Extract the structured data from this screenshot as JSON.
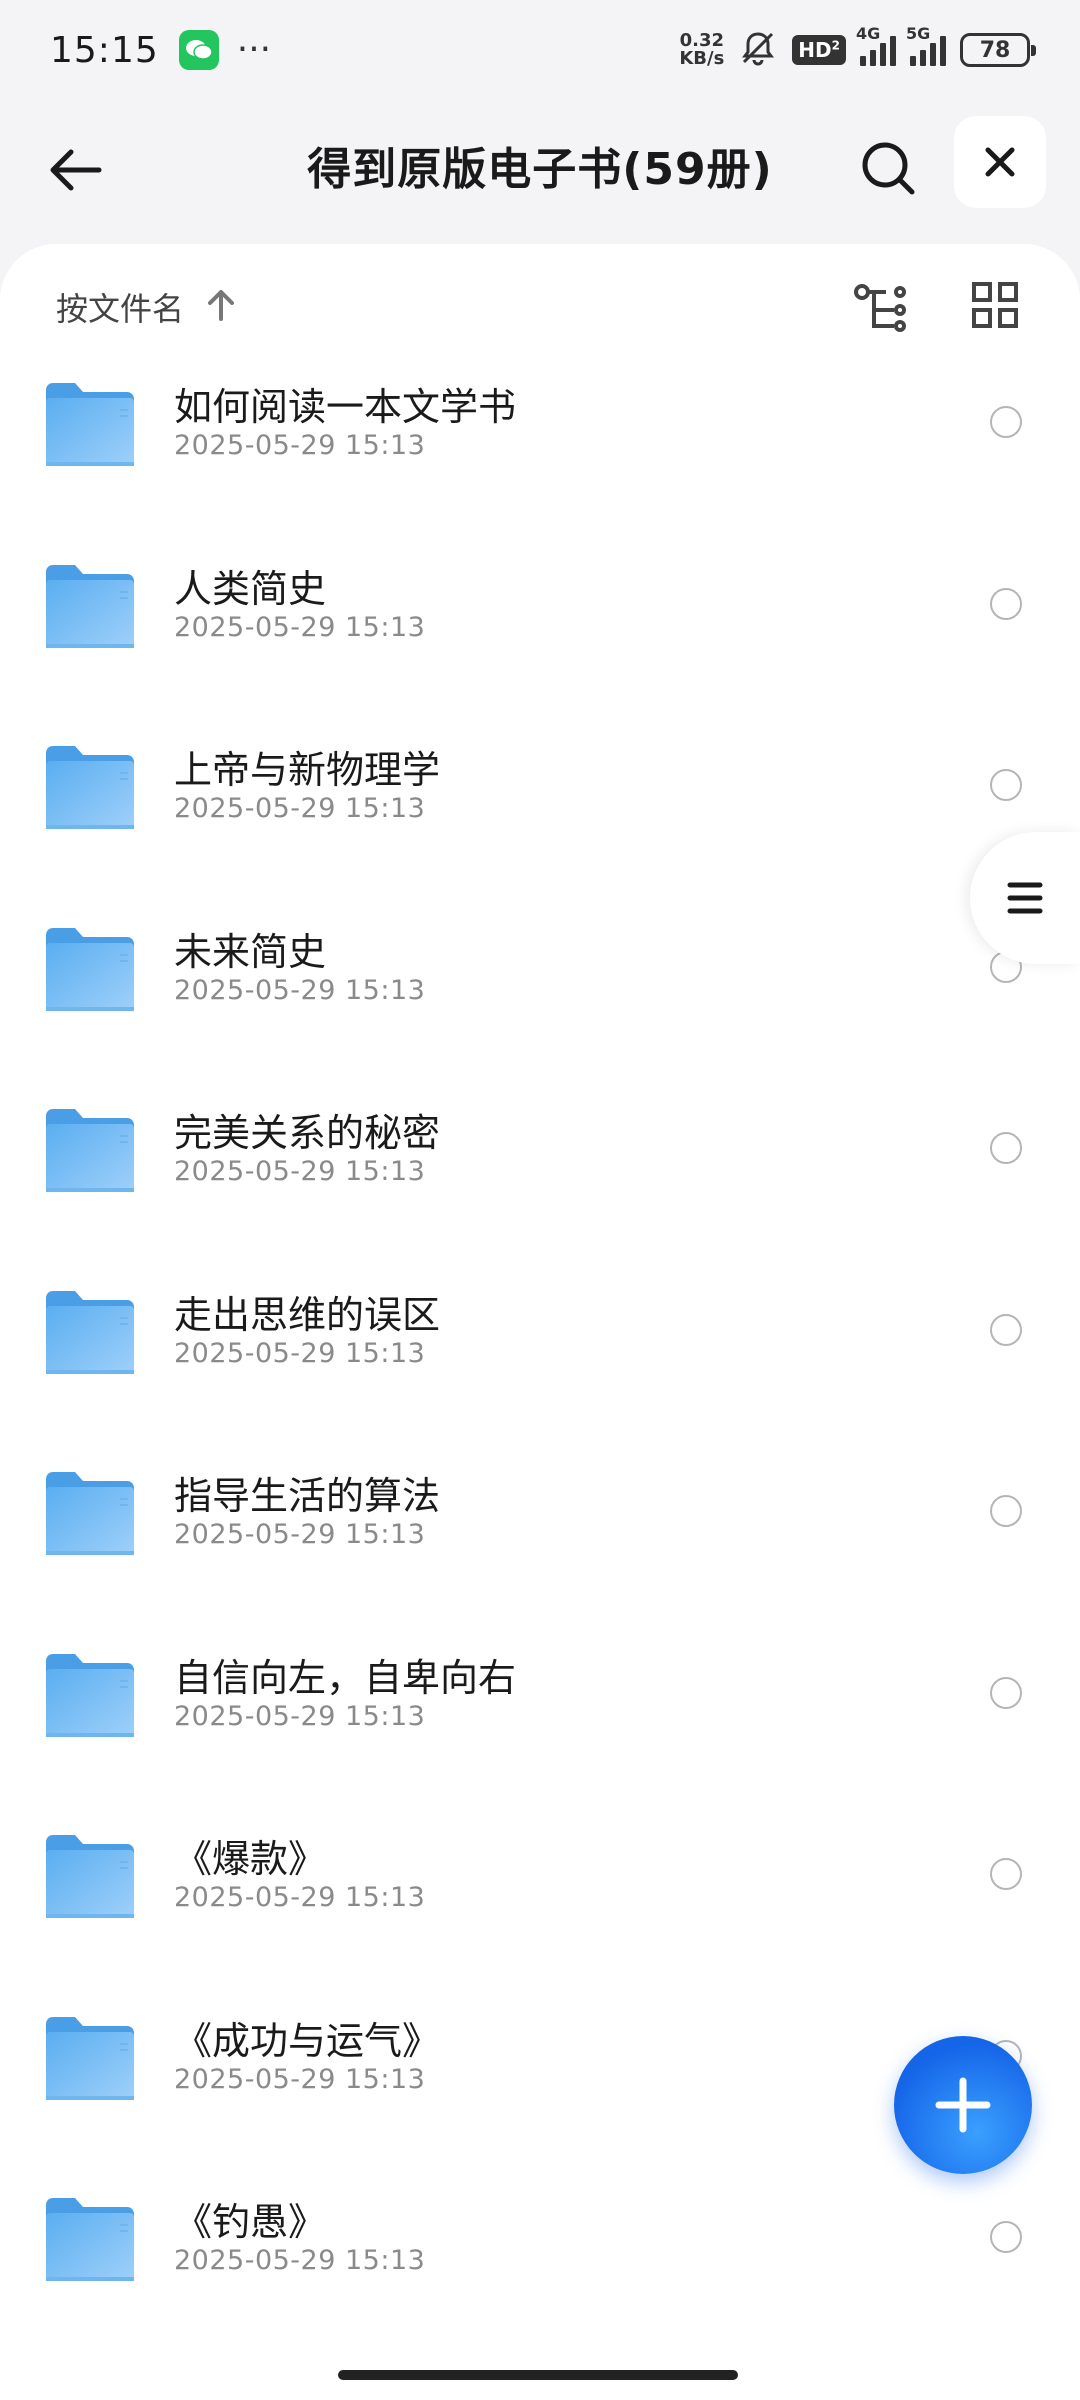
{
  "status_bar": {
    "time": "15:15",
    "dots": "···",
    "net_speed_value": "0.32",
    "net_speed_unit": "KB/s",
    "hd_label": "HD",
    "hd_sub": "2",
    "net_4g": "4G",
    "net_5g": "5G",
    "battery": "78"
  },
  "header": {
    "title": "得到原版电子书(59册)"
  },
  "toolbar": {
    "sort_label": "按文件名"
  },
  "files": [
    {
      "name": "如何阅读一本文学书",
      "date": "2025-05-29 15:13"
    },
    {
      "name": "人类简史",
      "date": "2025-05-29 15:13"
    },
    {
      "name": "上帝与新物理学",
      "date": "2025-05-29 15:13"
    },
    {
      "name": "未来简史",
      "date": "2025-05-29 15:13"
    },
    {
      "name": "完美关系的秘密",
      "date": "2025-05-29 15:13"
    },
    {
      "name": "走出思维的误区",
      "date": "2025-05-29 15:13"
    },
    {
      "name": "指导生活的算法",
      "date": "2025-05-29 15:13"
    },
    {
      "name": "自信向左，自卑向右",
      "date": "2025-05-29 15:13"
    },
    {
      "name": "《爆款》",
      "date": "2025-05-29 15:13"
    },
    {
      "name": "《成功与运气》",
      "date": "2025-05-29 15:13"
    },
    {
      "name": "《钓愚》",
      "date": "2025-05-29 15:13"
    }
  ],
  "colors": {
    "accent": "#1565e8",
    "folder": "#5ab0f2",
    "wechat": "#22c55e"
  }
}
